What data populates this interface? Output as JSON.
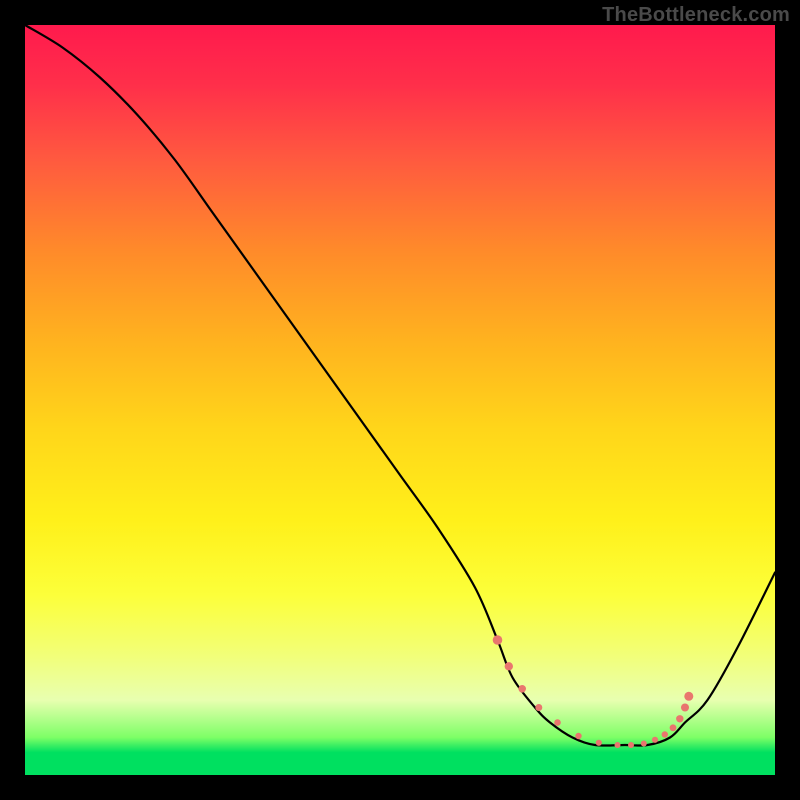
{
  "watermark": "TheBottleneck.com",
  "colors": {
    "page_bg": "#000000",
    "gradient_top": "#ff1a4d",
    "gradient_bottom": "#00e060",
    "curve_stroke": "#000000",
    "dot_fill": "#e9766e"
  },
  "chart_data": {
    "type": "line",
    "title": "",
    "xlabel": "",
    "ylabel": "",
    "xlim": [
      0,
      100
    ],
    "ylim": [
      0,
      100
    ],
    "grid": false,
    "legend": false,
    "note": "No axis labels or tick labels rendered; numeric values are estimated from pixel positions (0–100 scale, origin bottom-left).",
    "series": [
      {
        "name": "curve",
        "x": [
          0,
          5,
          10,
          15,
          20,
          25,
          30,
          35,
          40,
          45,
          50,
          55,
          60,
          63,
          65,
          68,
          70,
          73,
          76,
          80,
          83,
          86,
          88,
          91,
          95,
          100
        ],
        "y": [
          100,
          97,
          93,
          88,
          82,
          75,
          68,
          61,
          54,
          47,
          40,
          33,
          25,
          18,
          13,
          9,
          7,
          5,
          4,
          4,
          4,
          5,
          7,
          10,
          17,
          27
        ]
      }
    ],
    "markers": {
      "name": "highlight-dots",
      "x": [
        63.0,
        64.5,
        66.3,
        68.5,
        71.0,
        73.8,
        76.5,
        79.0,
        80.8,
        82.5,
        84.0,
        85.3,
        86.4,
        87.3,
        88.0,
        88.5
      ],
      "y": [
        18.0,
        14.5,
        11.5,
        9.0,
        7.0,
        5.2,
        4.3,
        4.0,
        4.0,
        4.2,
        4.7,
        5.4,
        6.3,
        7.5,
        9.0,
        10.5
      ],
      "r": [
        4.8,
        4.2,
        3.8,
        3.5,
        3.3,
        3.2,
        3.1,
        3.0,
        3.0,
        3.0,
        3.1,
        3.2,
        3.4,
        3.7,
        4.0,
        4.5
      ]
    }
  }
}
